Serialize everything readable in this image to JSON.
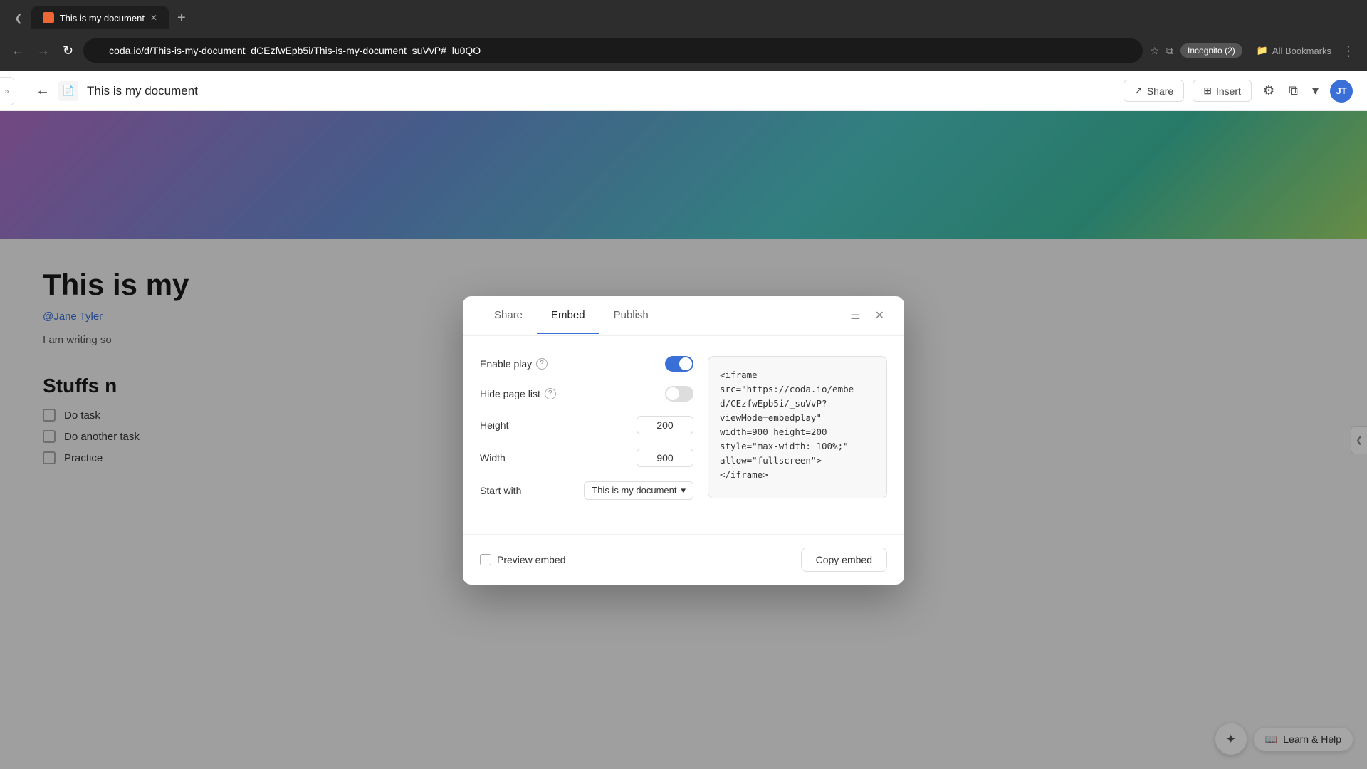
{
  "browser": {
    "tab_title": "This is my document",
    "url": "coda.io/d/This-is-my-document_dCEzfwEpb5i/This-is-my-document_suVvP#_lu0QO",
    "incognito_label": "Incognito (2)",
    "bookmarks_label": "All Bookmarks",
    "new_tab_label": "+"
  },
  "toolbar": {
    "doc_title": "This is my document",
    "share_label": "Share",
    "insert_label": "Insert",
    "avatar_initials": "JT"
  },
  "document": {
    "title": "This is my",
    "author": "@Jane Tyler",
    "body": "I am writing so",
    "section_title": "Stuffs n",
    "checkboxes": [
      {
        "label": "Do task"
      },
      {
        "label": "Do another task"
      },
      {
        "label": "Practice"
      }
    ]
  },
  "modal": {
    "tabs": [
      {
        "label": "Share",
        "active": false
      },
      {
        "label": "Embed",
        "active": true
      },
      {
        "label": "Publish",
        "active": false
      }
    ],
    "settings": {
      "enable_play_label": "Enable play",
      "hide_page_list_label": "Hide page list",
      "height_label": "Height",
      "height_value": "200",
      "width_label": "Width",
      "width_value": "900",
      "start_with_label": "Start with",
      "start_with_value": "This is my document"
    },
    "code": "<iframe\nsrc=\"https://coda.io/embe\nd/CEzfwEpb5i/_suVvP?\nviewMode=embedplay\"\nwidth=900 height=200\nstyle=\"max-width: 100%;\"\nallow=\"fullscreen\">\n</iframe>",
    "footer": {
      "preview_embed_label": "Preview embed",
      "copy_embed_label": "Copy embed"
    }
  },
  "bottom_bar": {
    "learn_help_label": "Learn & Help"
  },
  "icons": {
    "back": "←",
    "forward": "→",
    "refresh": "↻",
    "lock": "🔒",
    "star": "☆",
    "window": "⧉",
    "chevron_down": "▾",
    "close": "✕",
    "settings": "⚙",
    "share_icon": "↗",
    "insert_icon": "⊞",
    "double_chevron": "»",
    "filter": "⚌",
    "sparkle": "✦",
    "question": "?",
    "book": "📖"
  }
}
